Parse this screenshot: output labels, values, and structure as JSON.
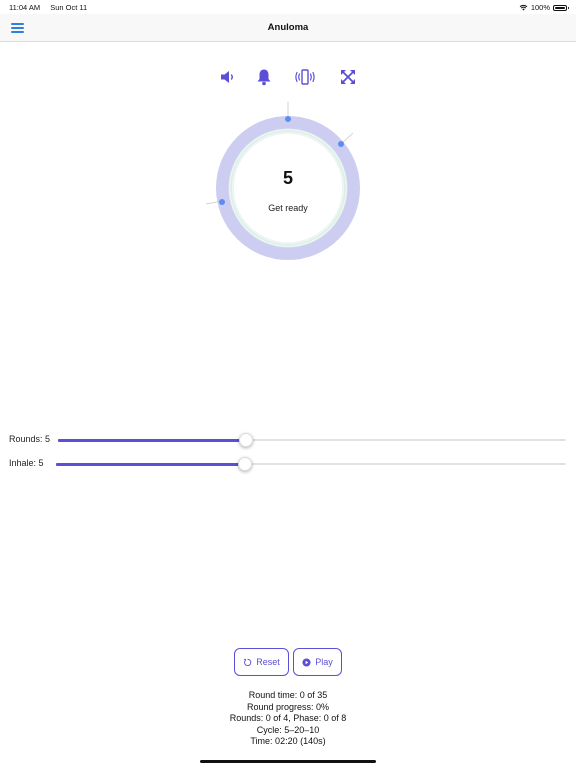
{
  "status_bar": {
    "time": "11:04 AM",
    "date": "Sun Oct 11",
    "battery_text": "100%",
    "icons": [
      "wifi-icon",
      "battery-icon"
    ]
  },
  "nav": {
    "title": "Anuloma",
    "menu_icon": "hamburger-menu-icon"
  },
  "toolbar": {
    "items": [
      {
        "icon": "speaker-icon"
      },
      {
        "icon": "bell-icon"
      },
      {
        "icon": "vibrate-icon"
      },
      {
        "icon": "fullscreen-icon"
      }
    ]
  },
  "breath": {
    "count": "5",
    "phase": "Get ready"
  },
  "sliders": {
    "rounds": {
      "label": "Rounds: 5",
      "fraction": 0.37
    },
    "inhale": {
      "label": "Inhale: 5",
      "fraction": 0.37
    }
  },
  "buttons": {
    "reset_label": "Reset",
    "play_label": "Play"
  },
  "stats": {
    "round_time": "Round time: 0 of 35",
    "round_progress": "Round progress: 0%",
    "rounds_phase": "Rounds: 0 of 4, Phase: 0 of 8",
    "cycle": "Cycle: 5–20–10",
    "time": "Time: 02:20 (140s)"
  },
  "colors": {
    "accent": "#5b4fd6",
    "ring_outer": "#cdcdf1",
    "ring_inner": "#d9f3e1",
    "marker": "#5b8ef0",
    "nav_icon": "#2f7fe0"
  }
}
